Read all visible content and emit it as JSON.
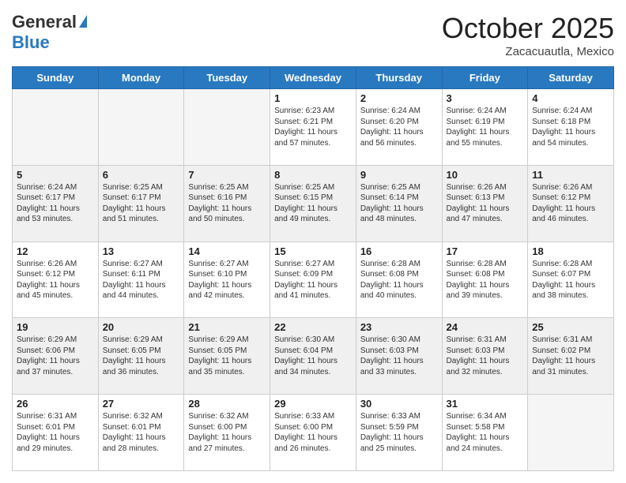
{
  "header": {
    "logo_general": "General",
    "logo_blue": "Blue",
    "month": "October 2025",
    "location": "Zacacuautla, Mexico"
  },
  "days": [
    "Sunday",
    "Monday",
    "Tuesday",
    "Wednesday",
    "Thursday",
    "Friday",
    "Saturday"
  ],
  "weeks": [
    [
      {
        "day": "",
        "text": "",
        "empty": true
      },
      {
        "day": "",
        "text": "",
        "empty": true
      },
      {
        "day": "",
        "text": "",
        "empty": true
      },
      {
        "day": "1",
        "text": "Sunrise: 6:23 AM\nSunset: 6:21 PM\nDaylight: 11 hours\nand 57 minutes.",
        "empty": false
      },
      {
        "day": "2",
        "text": "Sunrise: 6:24 AM\nSunset: 6:20 PM\nDaylight: 11 hours\nand 56 minutes.",
        "empty": false
      },
      {
        "day": "3",
        "text": "Sunrise: 6:24 AM\nSunset: 6:19 PM\nDaylight: 11 hours\nand 55 minutes.",
        "empty": false
      },
      {
        "day": "4",
        "text": "Sunrise: 6:24 AM\nSunset: 6:18 PM\nDaylight: 11 hours\nand 54 minutes.",
        "empty": false
      }
    ],
    [
      {
        "day": "5",
        "text": "Sunrise: 6:24 AM\nSunset: 6:17 PM\nDaylight: 11 hours\nand 53 minutes.",
        "empty": false
      },
      {
        "day": "6",
        "text": "Sunrise: 6:25 AM\nSunset: 6:17 PM\nDaylight: 11 hours\nand 51 minutes.",
        "empty": false
      },
      {
        "day": "7",
        "text": "Sunrise: 6:25 AM\nSunset: 6:16 PM\nDaylight: 11 hours\nand 50 minutes.",
        "empty": false
      },
      {
        "day": "8",
        "text": "Sunrise: 6:25 AM\nSunset: 6:15 PM\nDaylight: 11 hours\nand 49 minutes.",
        "empty": false
      },
      {
        "day": "9",
        "text": "Sunrise: 6:25 AM\nSunset: 6:14 PM\nDaylight: 11 hours\nand 48 minutes.",
        "empty": false
      },
      {
        "day": "10",
        "text": "Sunrise: 6:26 AM\nSunset: 6:13 PM\nDaylight: 11 hours\nand 47 minutes.",
        "empty": false
      },
      {
        "day": "11",
        "text": "Sunrise: 6:26 AM\nSunset: 6:12 PM\nDaylight: 11 hours\nand 46 minutes.",
        "empty": false
      }
    ],
    [
      {
        "day": "12",
        "text": "Sunrise: 6:26 AM\nSunset: 6:12 PM\nDaylight: 11 hours\nand 45 minutes.",
        "empty": false
      },
      {
        "day": "13",
        "text": "Sunrise: 6:27 AM\nSunset: 6:11 PM\nDaylight: 11 hours\nand 44 minutes.",
        "empty": false
      },
      {
        "day": "14",
        "text": "Sunrise: 6:27 AM\nSunset: 6:10 PM\nDaylight: 11 hours\nand 42 minutes.",
        "empty": false
      },
      {
        "day": "15",
        "text": "Sunrise: 6:27 AM\nSunset: 6:09 PM\nDaylight: 11 hours\nand 41 minutes.",
        "empty": false
      },
      {
        "day": "16",
        "text": "Sunrise: 6:28 AM\nSunset: 6:08 PM\nDaylight: 11 hours\nand 40 minutes.",
        "empty": false
      },
      {
        "day": "17",
        "text": "Sunrise: 6:28 AM\nSunset: 6:08 PM\nDaylight: 11 hours\nand 39 minutes.",
        "empty": false
      },
      {
        "day": "18",
        "text": "Sunrise: 6:28 AM\nSunset: 6:07 PM\nDaylight: 11 hours\nand 38 minutes.",
        "empty": false
      }
    ],
    [
      {
        "day": "19",
        "text": "Sunrise: 6:29 AM\nSunset: 6:06 PM\nDaylight: 11 hours\nand 37 minutes.",
        "empty": false
      },
      {
        "day": "20",
        "text": "Sunrise: 6:29 AM\nSunset: 6:05 PM\nDaylight: 11 hours\nand 36 minutes.",
        "empty": false
      },
      {
        "day": "21",
        "text": "Sunrise: 6:29 AM\nSunset: 6:05 PM\nDaylight: 11 hours\nand 35 minutes.",
        "empty": false
      },
      {
        "day": "22",
        "text": "Sunrise: 6:30 AM\nSunset: 6:04 PM\nDaylight: 11 hours\nand 34 minutes.",
        "empty": false
      },
      {
        "day": "23",
        "text": "Sunrise: 6:30 AM\nSunset: 6:03 PM\nDaylight: 11 hours\nand 33 minutes.",
        "empty": false
      },
      {
        "day": "24",
        "text": "Sunrise: 6:31 AM\nSunset: 6:03 PM\nDaylight: 11 hours\nand 32 minutes.",
        "empty": false
      },
      {
        "day": "25",
        "text": "Sunrise: 6:31 AM\nSunset: 6:02 PM\nDaylight: 11 hours\nand 31 minutes.",
        "empty": false
      }
    ],
    [
      {
        "day": "26",
        "text": "Sunrise: 6:31 AM\nSunset: 6:01 PM\nDaylight: 11 hours\nand 29 minutes.",
        "empty": false
      },
      {
        "day": "27",
        "text": "Sunrise: 6:32 AM\nSunset: 6:01 PM\nDaylight: 11 hours\nand 28 minutes.",
        "empty": false
      },
      {
        "day": "28",
        "text": "Sunrise: 6:32 AM\nSunset: 6:00 PM\nDaylight: 11 hours\nand 27 minutes.",
        "empty": false
      },
      {
        "day": "29",
        "text": "Sunrise: 6:33 AM\nSunset: 6:00 PM\nDaylight: 11 hours\nand 26 minutes.",
        "empty": false
      },
      {
        "day": "30",
        "text": "Sunrise: 6:33 AM\nSunset: 5:59 PM\nDaylight: 11 hours\nand 25 minutes.",
        "empty": false
      },
      {
        "day": "31",
        "text": "Sunrise: 6:34 AM\nSunset: 5:58 PM\nDaylight: 11 hours\nand 24 minutes.",
        "empty": false
      },
      {
        "day": "",
        "text": "",
        "empty": true
      }
    ]
  ]
}
